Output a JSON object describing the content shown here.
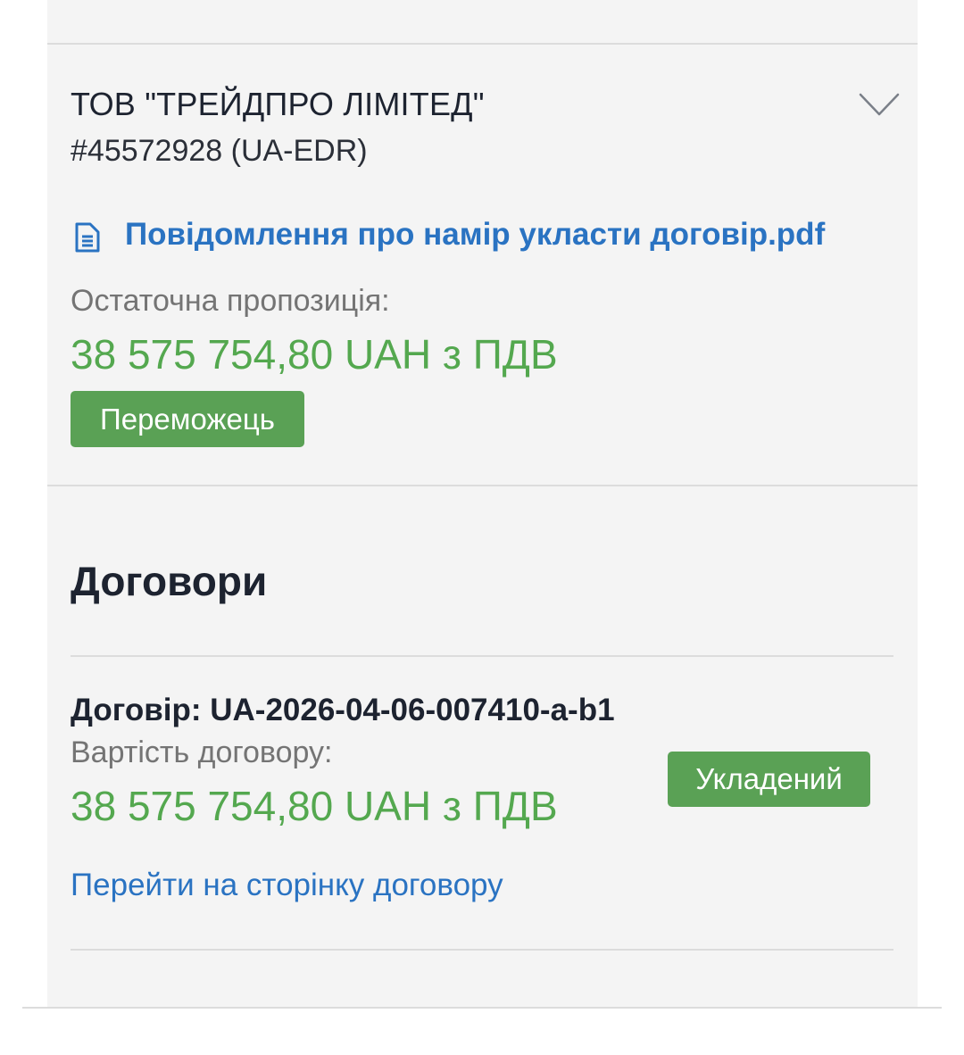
{
  "participant": {
    "name": "ТОВ \"ТРЕЙДПРО ЛІМІТЕД\"",
    "identifier": "#45572928 (UA-EDR)",
    "expand_icon": "chevron-down-icon",
    "document": {
      "icon": "file-document-icon",
      "link_text": "Повідомлення про намір укласти договір.pdf"
    },
    "offer_label": "Остаточна пропозиція:",
    "offer_amount": "38 575 754,80 UAH з ПДВ",
    "status_badge": "Переможець"
  },
  "contracts": {
    "title": "Договори",
    "items": [
      {
        "id_text": "Договір: UA-2026-04-06-007410-a-b1",
        "value_label": "Вартість договору:",
        "value_amount": "38 575 754,80 UAH з ПДВ",
        "status_badge": "Укладений",
        "link_text": "Перейти на сторінку договору"
      }
    ]
  },
  "colors": {
    "link": "#2a73c2",
    "amount": "#54a84f",
    "badge": "#5aa155",
    "panel_bg": "#f4f4f4"
  }
}
